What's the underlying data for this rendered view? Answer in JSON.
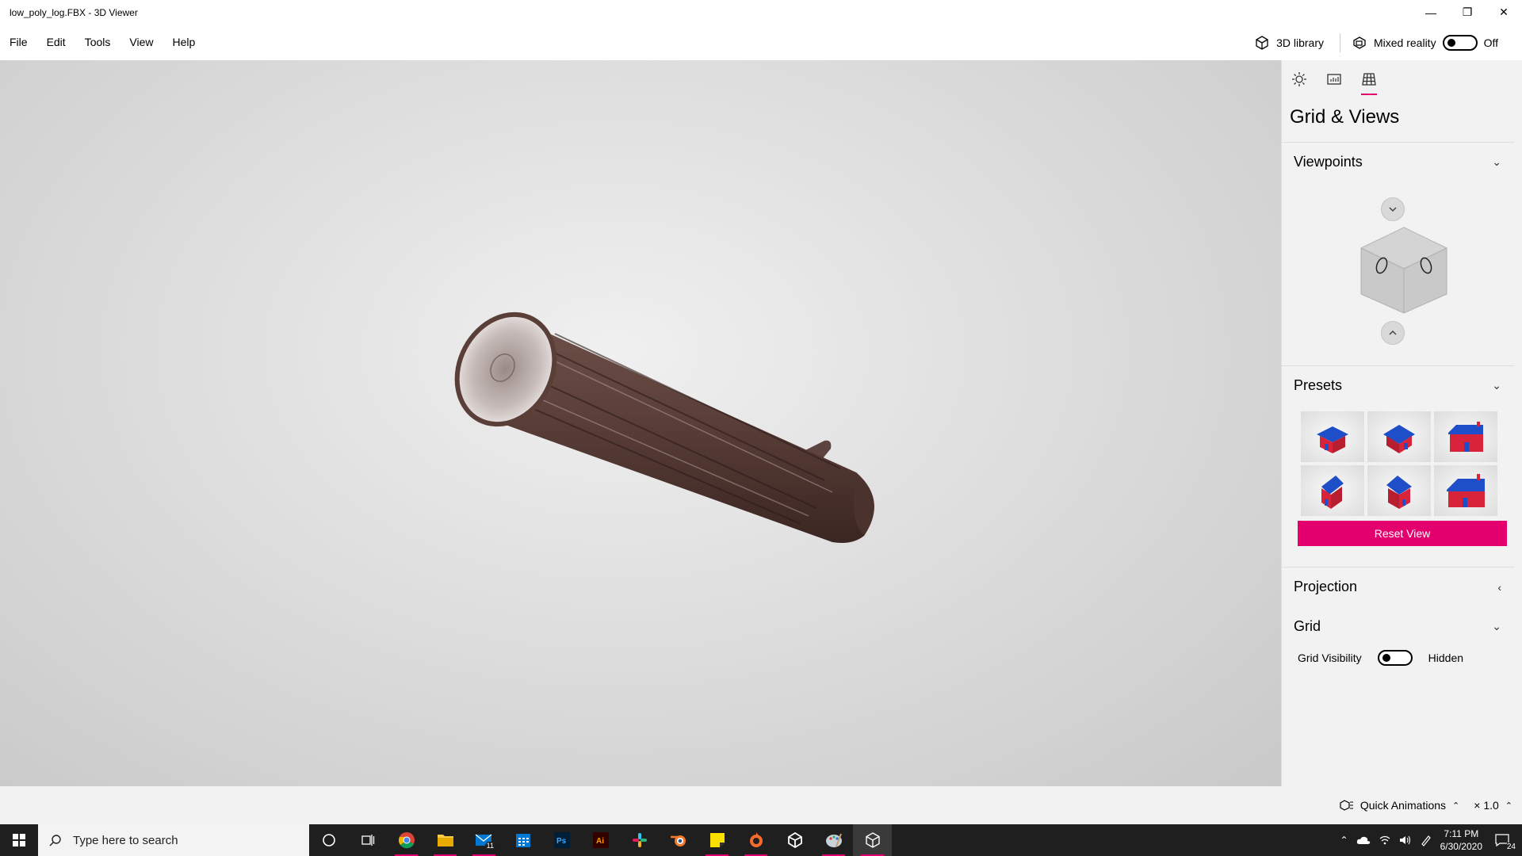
{
  "window": {
    "title": "low_poly_log.FBX - 3D Viewer"
  },
  "menu": {
    "items": [
      "File",
      "Edit",
      "Tools",
      "View",
      "Help"
    ]
  },
  "topbar": {
    "library_label": "3D library",
    "mixed_reality_label": "Mixed reality",
    "mixed_reality_state": "Off"
  },
  "panel": {
    "title": "Grid & Views",
    "sections": {
      "viewpoints": "Viewpoints",
      "presets": "Presets",
      "projection": "Projection",
      "grid": "Grid"
    },
    "reset_label": "Reset View",
    "grid_visibility_label": "Grid Visibility",
    "grid_visibility_state": "Hidden"
  },
  "statusbar": {
    "quick_animations": "Quick Animations",
    "speed": "× 1.0"
  },
  "taskbar": {
    "search_placeholder": "Type here to search",
    "mail_badge": "11",
    "time": "7:11 PM",
    "date": "6/30/2020",
    "notifications": "24"
  },
  "colors": {
    "accent": "#e3006e",
    "house_roof": "#1f4fc8",
    "house_wall": "#d8243a"
  }
}
